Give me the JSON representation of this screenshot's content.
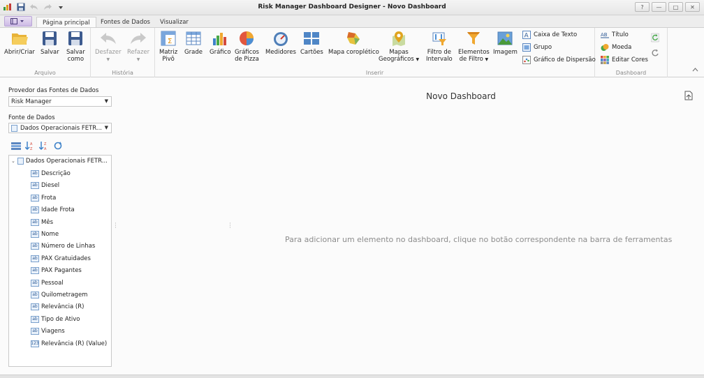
{
  "window": {
    "title": "Risk Manager Dashboard Designer - Novo Dashboard",
    "controls": {
      "help": "?",
      "minimize": "—",
      "maximize": "□",
      "close": "✕"
    }
  },
  "ribbon_tabs": [
    "Página principal",
    "Fontes de Dados",
    "Visualizar"
  ],
  "ribbon": {
    "arquivo": {
      "label": "Arquivo",
      "open": "Abrir/Criar",
      "save": "Salvar",
      "save_as_1": "Salvar",
      "save_as_2": "como"
    },
    "historia": {
      "label": "História",
      "undo": "Desfazer",
      "redo": "Refazer"
    },
    "inserir": {
      "label": "Inserir",
      "matrix_1": "Matriz",
      "matrix_2": "Pivô",
      "grid": "Grade",
      "chart": "Gráfico",
      "pie_1": "Gráficos",
      "pie_2": "de Pizza",
      "gauges": "Medidores",
      "cards": "Cartões",
      "choropleth": "Mapa coroplético",
      "geo_1": "Mapas",
      "geo_2": "Geográficos",
      "range_1": "Filtro de",
      "range_2": "Intervalo",
      "filter_1": "Elementos",
      "filter_2": "de Filtro",
      "image": "Imagem",
      "textbox": "Caixa de Texto",
      "group": "Grupo",
      "scatter": "Gráfico de Dispersão"
    },
    "dashboard": {
      "label": "Dashboard",
      "title": "Título",
      "currency": "Moeda",
      "colors": "Editar Cores"
    }
  },
  "left_panel": {
    "provider_label": "Provedor das Fontes de Dados",
    "provider_value": "Risk Manager",
    "source_label": "Fonte de Dados",
    "source_value": "Dados Operacionais FETR...",
    "tree_root": "Dados Operacionais FETR...",
    "fields": [
      {
        "name": "Descrição",
        "type": "ab"
      },
      {
        "name": "Diesel",
        "type": "ab"
      },
      {
        "name": "Frota",
        "type": "ab"
      },
      {
        "name": "Idade Frota",
        "type": "ab"
      },
      {
        "name": "Mês",
        "type": "ab"
      },
      {
        "name": "Nome",
        "type": "ab"
      },
      {
        "name": "Número de Linhas",
        "type": "ab"
      },
      {
        "name": "PAX Gratuidades",
        "type": "ab"
      },
      {
        "name": "PAX Pagantes",
        "type": "ab"
      },
      {
        "name": "Pessoal",
        "type": "ab"
      },
      {
        "name": "Quilometragem",
        "type": "ab"
      },
      {
        "name": "Relevância (R)",
        "type": "ab"
      },
      {
        "name": "Tipo de Ativo",
        "type": "ab"
      },
      {
        "name": "Viagens",
        "type": "ab"
      },
      {
        "name": "Relevância (R) (Value)",
        "type": "123"
      }
    ]
  },
  "canvas": {
    "title": "Novo Dashboard",
    "hint": "Para adicionar um elemento no dashboard, clique no botão correspondente na barra de ferramentas"
  }
}
